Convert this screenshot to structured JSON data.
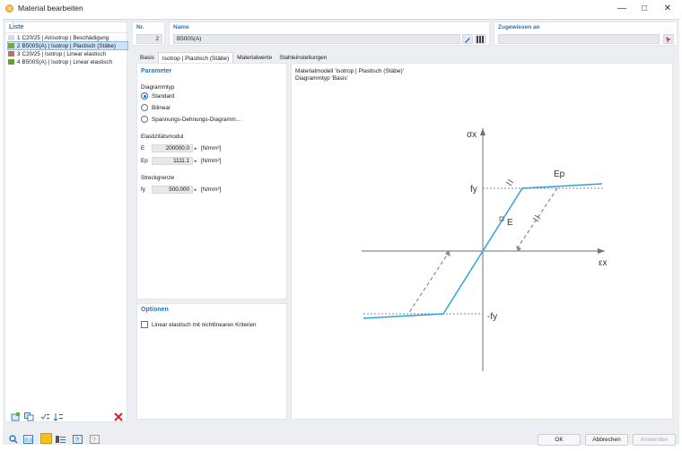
{
  "window": {
    "title": "Material bearbeiten"
  },
  "liste": {
    "title": "Liste",
    "items": [
      {
        "num": "1",
        "label": "C20/25 | Anisotrop | Beschädigung",
        "color": "#d9d9d9"
      },
      {
        "num": "2",
        "label": "B500S(A) | Isotrop | Plastisch (Stäbe)",
        "color": "#7ea832"
      },
      {
        "num": "3",
        "label": "C20/25 | Isotrop | Linear elastisch",
        "color": "#b76e6e"
      },
      {
        "num": "4",
        "label": "B500S(A) | Isotrop | Linear elastisch",
        "color": "#5aa822"
      }
    ]
  },
  "header": {
    "nr_label": "Nr.",
    "nr_value": "2",
    "name_label": "Name",
    "name_value": "B500S(A)",
    "assigned_label": "Zugewiesen an",
    "assigned_value": ""
  },
  "tabs": [
    "Basis",
    "Isotrop | Plastisch (Stäbe)",
    "Materialwerte",
    "Stahleinstellungen"
  ],
  "parameter": {
    "title": "Parameter",
    "diagrammtyp_label": "Diagrammtyp",
    "options": [
      "Standard",
      "Bilinear",
      "Spannungs-Dehnungs-Diagramm..."
    ],
    "elast_label": "Elastizitätsmodul",
    "e_label": "E",
    "e_value": "200000.0",
    "ep_label": "Ep",
    "ep_value": "1111.1",
    "unit": "[N/mm²]",
    "streck_label": "Streckgrenze",
    "fy_label": "fy",
    "fy_value": "500.000"
  },
  "optionen": {
    "title": "Optionen",
    "checkbox_label": "Linear elastisch mit nichtlinearen Kriterien"
  },
  "diagram": {
    "line1": "Materialmodell 'Isotrop | Plastisch (Stäbe)'",
    "line2": "Diagrammtyp 'Basis'",
    "sigma_label": "σx",
    "eps_label": "εx",
    "fy_label": "fy",
    "neg_fy_label": "-fy",
    "e_label": "E",
    "ep_label": "Ep"
  },
  "footer": {
    "ok": "OK",
    "cancel": "Abbrechen",
    "apply": "Anwenden"
  },
  "colors": {
    "accent": "#2a74b8",
    "curve": "#2fa3dc"
  }
}
